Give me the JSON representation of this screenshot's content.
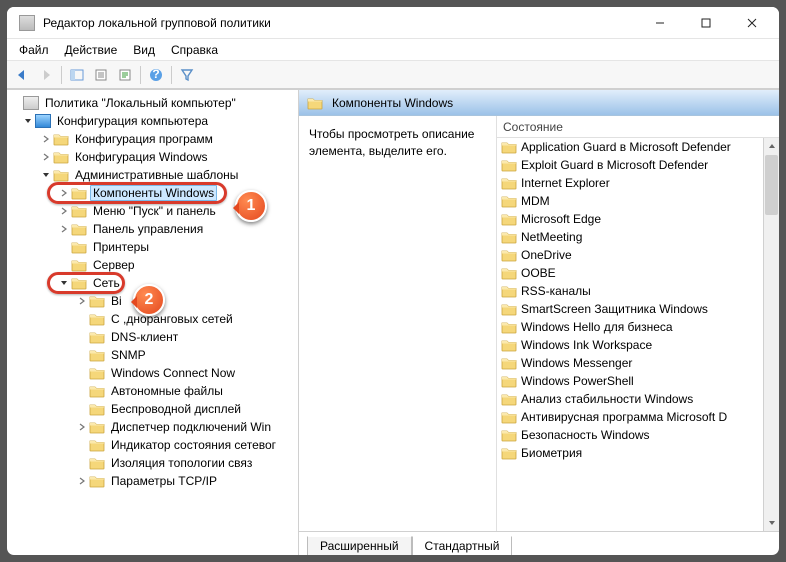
{
  "title": "Редактор локальной групповой политики",
  "menu": {
    "file": "Файл",
    "action": "Действие",
    "view": "Вид",
    "help": "Справка"
  },
  "tree": {
    "root": "Политика \"Локальный компьютер\"",
    "computer": "Конфигурация компьютера",
    "cfg_programs": "Конфигурация программ",
    "cfg_windows": "Конфигурация Windows",
    "admin_templates": "Административные шаблоны",
    "components": "Компоненты Windows",
    "start_menu": "Меню \"Пуск\" и панель",
    "control_panel": "Панель управления",
    "printers": "Принтеры",
    "server": "Сервер",
    "network": "Сеть",
    "bits_truncated": "Bi",
    "p2p": "С         ,дноранговых сетей",
    "dns_client": "DNS-клиент",
    "snmp": "SNMP",
    "wcn": "Windows Connect Now",
    "offline_files": "Автономные файлы",
    "wireless": "Беспроводной дисплей",
    "conn_dispatcher": "Диспетчер подключений Win",
    "net_indicator": "Индикатор состояния сетевог",
    "topology": "Изоляция топологии связ",
    "tcpip": "Параметры TCP/IP"
  },
  "right": {
    "header": "Компоненты Windows",
    "desc": "Чтобы просмотреть описание элемента, выделите его.",
    "col_status": "Состояние",
    "items": [
      "Application Guard в Microsoft Defender",
      "Exploit Guard в Microsoft Defender",
      "Internet Explorer",
      "MDM",
      "Microsoft Edge",
      "NetMeeting",
      "OneDrive",
      "OOBE",
      "RSS-каналы",
      "SmartScreen Защитника Windows",
      "Windows Hello для бизнеса",
      "Windows Ink Workspace",
      "Windows Messenger",
      "Windows PowerShell",
      "Анализ стабильности Windows",
      "Антивирусная программа Microsoft D",
      "Безопасность Windows",
      "Биометрия"
    ]
  },
  "tabs": {
    "extended": "Расширенный",
    "standard": "Стандартный"
  },
  "callouts": {
    "c1": "1",
    "c2": "2"
  }
}
